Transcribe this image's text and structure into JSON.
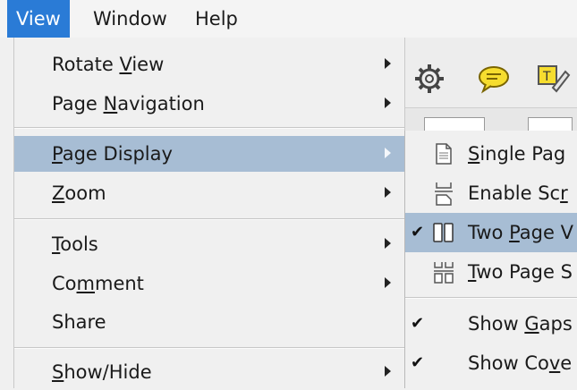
{
  "menubar": {
    "items": [
      "View",
      "Window",
      "Help"
    ],
    "active": "View"
  },
  "menu": {
    "items": [
      {
        "label_pre": "Rotate ",
        "mnemonic": "V",
        "label_post": "iew",
        "submenu": true
      },
      {
        "label_pre": "Page ",
        "mnemonic": "N",
        "label_post": "avigation",
        "submenu": true
      },
      {
        "label_pre": "",
        "mnemonic": "P",
        "label_post": "age Display",
        "submenu": true,
        "highlighted": true
      },
      {
        "label_pre": "",
        "mnemonic": "Z",
        "label_post": "oom",
        "submenu": true
      },
      {
        "label_pre": "",
        "mnemonic": "T",
        "label_post": "ools",
        "submenu": true
      },
      {
        "label_pre": "Co",
        "mnemonic": "m",
        "label_post": "ment",
        "submenu": true
      },
      {
        "label_pre": "Share",
        "mnemonic": "",
        "label_post": "",
        "submenu": false
      },
      {
        "label_pre": "",
        "mnemonic": "S",
        "label_post": "how/Hide",
        "submenu": true
      }
    ]
  },
  "submenu": {
    "items": [
      {
        "label_pre": "",
        "mnemonic": "S",
        "label_post": "ingle Pag",
        "icon": "single-page-icon",
        "checked": false
      },
      {
        "label_pre": "Enable Sc",
        "mnemonic": "r",
        "label_post": "",
        "icon": "enable-scrolling-icon",
        "checked": false
      },
      {
        "label_pre": "Two ",
        "mnemonic": "P",
        "label_post": "age V",
        "icon": "two-page-view-icon",
        "checked": true,
        "highlighted": true
      },
      {
        "label_pre": "",
        "mnemonic": "T",
        "label_post": "wo Page S",
        "icon": "two-page-scrolling-icon",
        "checked": false
      },
      {
        "label_pre": "Show ",
        "mnemonic": "G",
        "label_post": "aps",
        "icon": "",
        "checked": true
      },
      {
        "label_pre": "Show Co",
        "mnemonic": "v",
        "label_post": "e",
        "icon": "",
        "checked": true
      }
    ]
  },
  "colors": {
    "active_menubar": "#2a7bd6",
    "highlight": "#a7bdd4",
    "menu_bg": "#f0f0f0"
  },
  "toolbar_icons": [
    "gear-icon",
    "comment-icon",
    "highlight-text-icon"
  ]
}
